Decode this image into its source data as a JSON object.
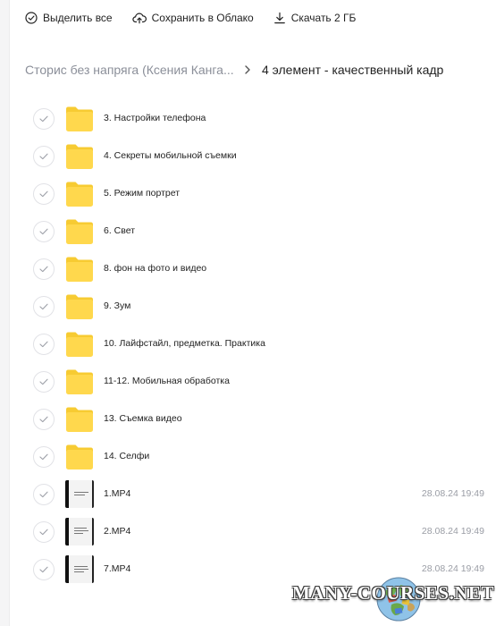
{
  "toolbar": {
    "select_all": "Выделить все",
    "save_to_cloud": "Сохранить в Облако",
    "download": "Скачать 2 ГБ"
  },
  "breadcrumb": {
    "parent": "Сторис без напряга (Ксения Канга...",
    "current": "4 элемент - качественный кадр"
  },
  "items": [
    {
      "name": "3. Настройки телефона",
      "type": "folder",
      "date": ""
    },
    {
      "name": "4. Секреты мобильной съемки",
      "type": "folder",
      "date": ""
    },
    {
      "name": "5. Режим портрет",
      "type": "folder",
      "date": ""
    },
    {
      "name": "6. Свет",
      "type": "folder",
      "date": ""
    },
    {
      "name": "8. фон на фото и видео",
      "type": "folder",
      "date": ""
    },
    {
      "name": "9. Зум",
      "type": "folder",
      "date": ""
    },
    {
      "name": "10. Лайфстайл, предметка. Практика",
      "type": "folder",
      "date": ""
    },
    {
      "name": "11-12. Мобильная обработка",
      "type": "folder",
      "date": ""
    },
    {
      "name": "13. Съемка видео",
      "type": "folder",
      "date": ""
    },
    {
      "name": "14. Селфи",
      "type": "folder",
      "date": ""
    },
    {
      "name": "1.MP4",
      "type": "video",
      "date": "28.08.24 19:49"
    },
    {
      "name": "2.MP4",
      "type": "video",
      "date": "28.08.24 19:49"
    },
    {
      "name": "7.MP4",
      "type": "video",
      "date": "28.08.24 19:49"
    }
  ],
  "watermark": {
    "text": "MANY-COURSES.NET"
  },
  "colors": {
    "folder": "#ffd84d",
    "folder_tab": "#f7cb32",
    "muted_text": "#8b8f99",
    "date_text": "#9a9da5",
    "check_border": "#e1e2e6"
  }
}
